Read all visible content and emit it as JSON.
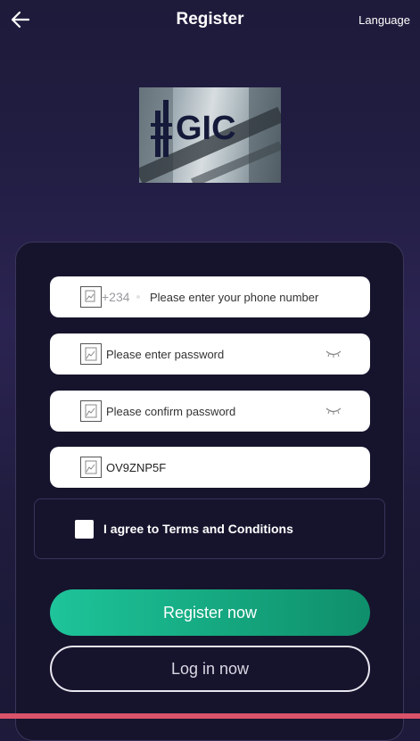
{
  "header": {
    "title": "Register",
    "language_label": "Language",
    "back_icon": "arrow-left-icon"
  },
  "logo": {
    "text": "GIC"
  },
  "form": {
    "phone": {
      "prefix": "+234",
      "placeholder": "Please enter your phone number",
      "value": ""
    },
    "password": {
      "placeholder": "Please enter password",
      "value": ""
    },
    "confirm_password": {
      "placeholder": "Please confirm password",
      "value": ""
    },
    "invite_code": {
      "placeholder": "",
      "value": "OV9ZNP5F"
    },
    "agree_label": "I agree to Terms and Conditions",
    "agree_checked": false
  },
  "actions": {
    "register_label": "Register now",
    "login_label": "Log in now"
  },
  "colors": {
    "primary": "#15a77f",
    "background": "#1e1b3c",
    "accent_bar": "#d9536a"
  }
}
